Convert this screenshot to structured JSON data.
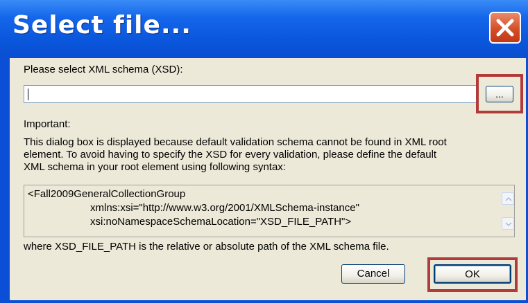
{
  "window": {
    "title": "Select file..."
  },
  "dialog": {
    "prompt_label": "Please select XML schema (XSD):",
    "path_value": "",
    "browse_label": "...",
    "important_label": "Important:",
    "info_line1": "This dialog box is displayed because default validation schema cannot be found in XML root",
    "info_line2": "element. To avoid having to specify the XSD for every validation, please define the default",
    "info_line3": "XML schema in your root element using following syntax:",
    "syntax_line1": "<Fall2009GeneralCollectionGroup",
    "syntax_line2": "xmlns:xsi=\"http://www.w3.org/2001/XMLSchema-instance\"",
    "syntax_line3": "xsi:noNamespaceSchemaLocation=\"XSD_FILE_PATH\">",
    "footer_note": "where XSD_FILE_PATH is the relative or absolute path of the XML schema file.",
    "cancel_label": "Cancel",
    "ok_label": "OK"
  },
  "colors": {
    "titlebar": "#0a56dc",
    "close_button": "#d24a22",
    "dialog_face": "#ece9d8",
    "highlight": "#b23a3a"
  },
  "icons": [
    "close-icon",
    "scroll-up-icon",
    "scroll-down-icon"
  ]
}
